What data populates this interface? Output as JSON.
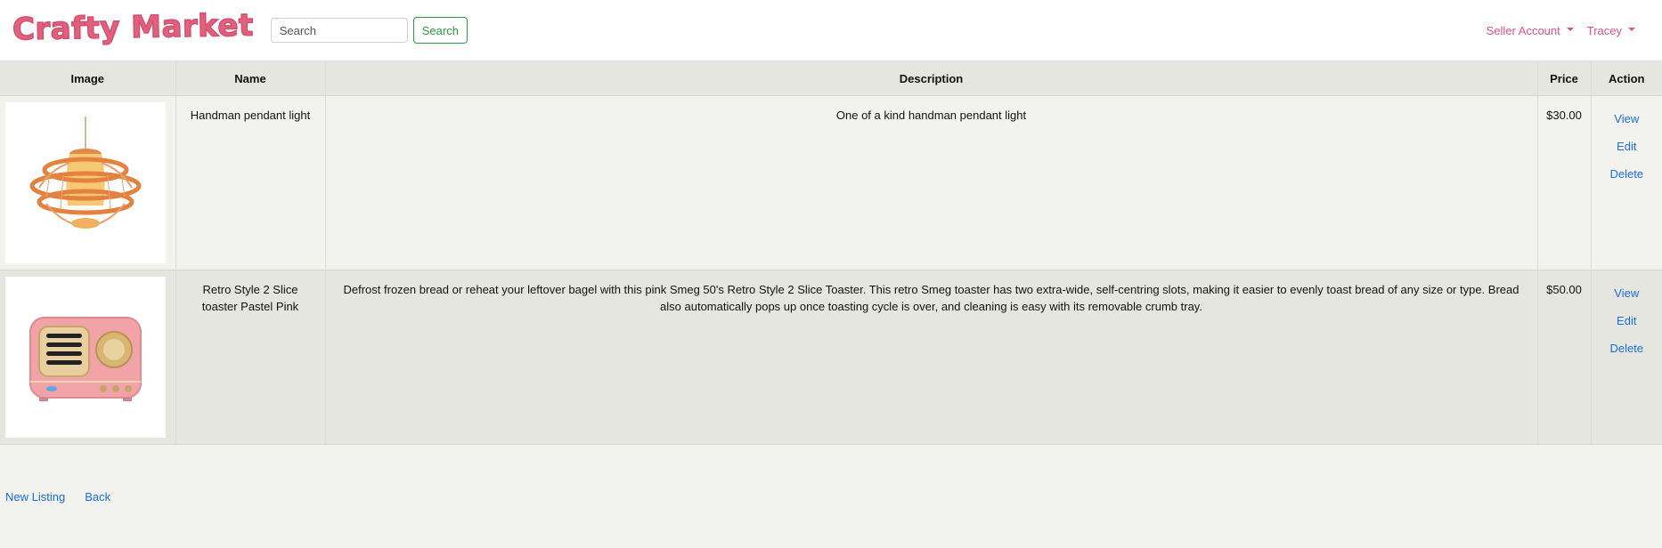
{
  "navbar": {
    "brand": "Crafty Market",
    "search_placeholder": "Search",
    "search_button": "Search",
    "seller_account": "Seller Account",
    "user_menu": "Tracey",
    "accent_color": "#d9548a"
  },
  "table": {
    "headers": {
      "image": "Image",
      "name": "Name",
      "description": "Description",
      "price": "Price",
      "action": "Action"
    },
    "rows": [
      {
        "image_icon": "pendant-light-image",
        "name": "Handman pendant light",
        "description": "One of a kind handman pendant light",
        "price": "$30.00",
        "actions": {
          "view": "View",
          "edit": "Edit",
          "delete": "Delete"
        }
      },
      {
        "image_icon": "pink-radio-toaster-image",
        "name": "Retro Style 2 Slice toaster Pastel Pink",
        "description": "Defrost frozen bread or reheat your leftover bagel with this pink Smeg 50's Retro Style 2 Slice Toaster. This retro Smeg toaster has two extra-wide, self-centring slots, making it easier to evenly toast bread of any size or type. Bread also automatically pops up once toasting cycle is over, and cleaning is easy with its removable crumb tray.",
        "price": "$50.00",
        "actions": {
          "view": "View",
          "edit": "Edit",
          "delete": "Delete"
        }
      }
    ]
  },
  "footer": {
    "new_listing": "New Listing",
    "back": "Back"
  }
}
